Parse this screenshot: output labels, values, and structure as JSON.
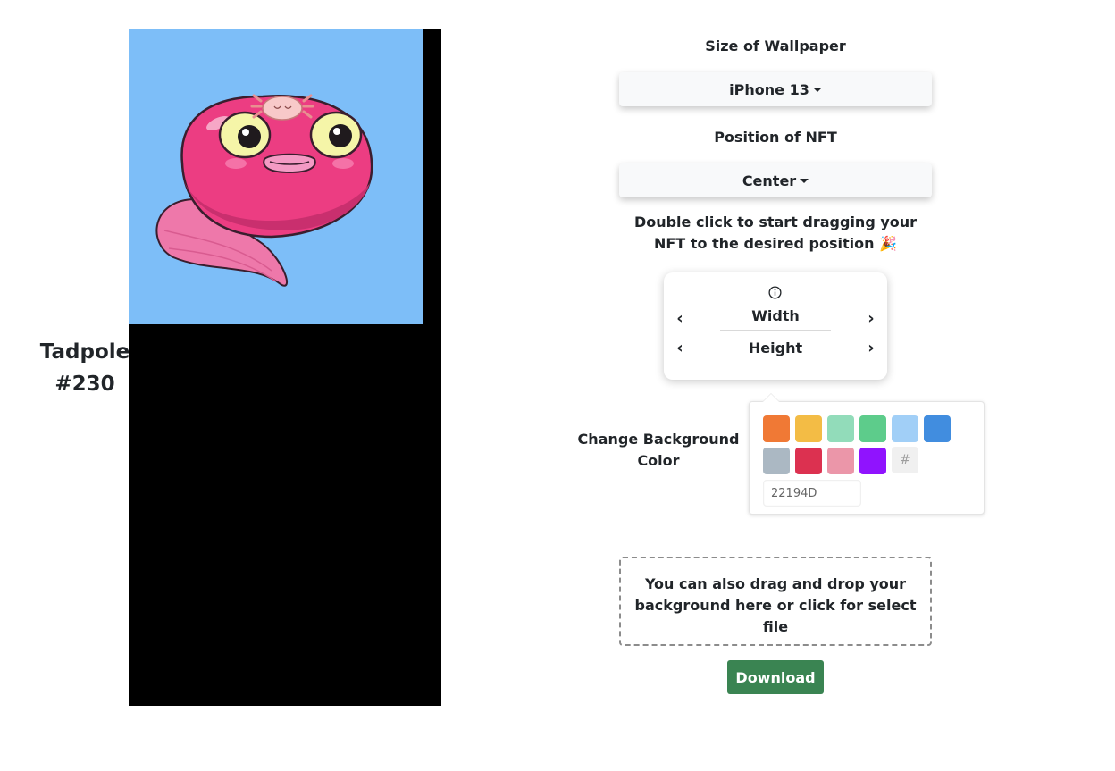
{
  "nft": {
    "title_line1": "Tadpole",
    "title_line2": "#230",
    "background_color": "#7dbef8",
    "preview_background": "#000000"
  },
  "controls": {
    "size_label": "Size of Wallpaper",
    "size_value": "iPhone 13",
    "position_label": "Position of NFT",
    "position_value": "Center",
    "drag_hint": "Double click to start dragging your NFT to the desired position 🎉",
    "info_icon": "info-icon",
    "width_label": "Width",
    "height_label": "Height",
    "decrease_symbol": "‹",
    "increase_symbol": "›"
  },
  "background": {
    "label": "Change Background Color",
    "swatches": [
      "#f07935",
      "#f3bc45",
      "#92dcba",
      "#5dcc8b",
      "#a1cff7",
      "#418ddf",
      "#abb8c3",
      "#dc3150",
      "#eb96a9",
      "#9013fe"
    ],
    "hash_symbol": "#",
    "hex_value": "22194D"
  },
  "dropzone": {
    "text": "You can also drag and drop your background here or click for select file"
  },
  "download_label": "Download"
}
